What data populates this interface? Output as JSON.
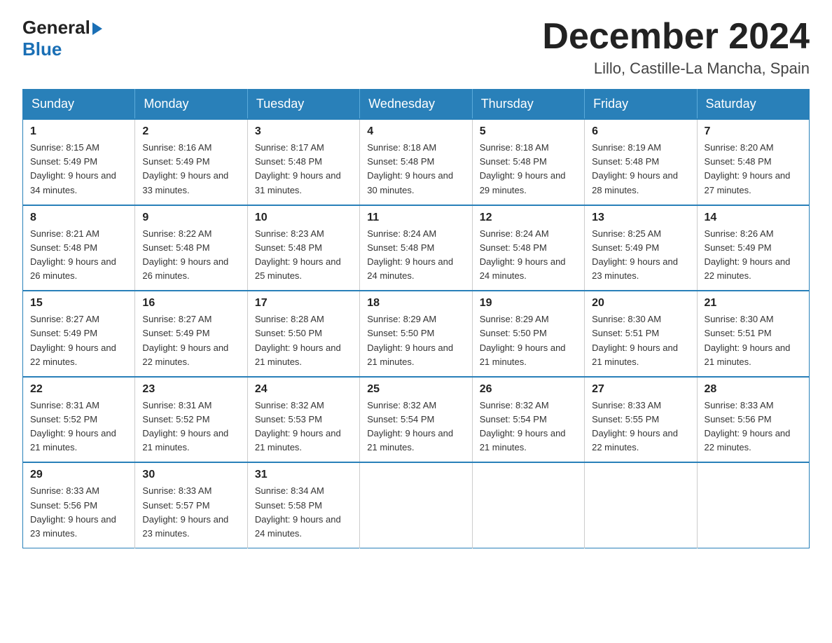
{
  "header": {
    "logo_general": "General",
    "logo_blue": "Blue",
    "month_title": "December 2024",
    "location": "Lillo, Castille-La Mancha, Spain"
  },
  "days_of_week": [
    "Sunday",
    "Monday",
    "Tuesday",
    "Wednesday",
    "Thursday",
    "Friday",
    "Saturday"
  ],
  "weeks": [
    [
      {
        "day": "1",
        "sunrise": "8:15 AM",
        "sunset": "5:49 PM",
        "daylight": "9 hours and 34 minutes."
      },
      {
        "day": "2",
        "sunrise": "8:16 AM",
        "sunset": "5:49 PM",
        "daylight": "9 hours and 33 minutes."
      },
      {
        "day": "3",
        "sunrise": "8:17 AM",
        "sunset": "5:48 PM",
        "daylight": "9 hours and 31 minutes."
      },
      {
        "day": "4",
        "sunrise": "8:18 AM",
        "sunset": "5:48 PM",
        "daylight": "9 hours and 30 minutes."
      },
      {
        "day": "5",
        "sunrise": "8:18 AM",
        "sunset": "5:48 PM",
        "daylight": "9 hours and 29 minutes."
      },
      {
        "day": "6",
        "sunrise": "8:19 AM",
        "sunset": "5:48 PM",
        "daylight": "9 hours and 28 minutes."
      },
      {
        "day": "7",
        "sunrise": "8:20 AM",
        "sunset": "5:48 PM",
        "daylight": "9 hours and 27 minutes."
      }
    ],
    [
      {
        "day": "8",
        "sunrise": "8:21 AM",
        "sunset": "5:48 PM",
        "daylight": "9 hours and 26 minutes."
      },
      {
        "day": "9",
        "sunrise": "8:22 AM",
        "sunset": "5:48 PM",
        "daylight": "9 hours and 26 minutes."
      },
      {
        "day": "10",
        "sunrise": "8:23 AM",
        "sunset": "5:48 PM",
        "daylight": "9 hours and 25 minutes."
      },
      {
        "day": "11",
        "sunrise": "8:24 AM",
        "sunset": "5:48 PM",
        "daylight": "9 hours and 24 minutes."
      },
      {
        "day": "12",
        "sunrise": "8:24 AM",
        "sunset": "5:48 PM",
        "daylight": "9 hours and 24 minutes."
      },
      {
        "day": "13",
        "sunrise": "8:25 AM",
        "sunset": "5:49 PM",
        "daylight": "9 hours and 23 minutes."
      },
      {
        "day": "14",
        "sunrise": "8:26 AM",
        "sunset": "5:49 PM",
        "daylight": "9 hours and 22 minutes."
      }
    ],
    [
      {
        "day": "15",
        "sunrise": "8:27 AM",
        "sunset": "5:49 PM",
        "daylight": "9 hours and 22 minutes."
      },
      {
        "day": "16",
        "sunrise": "8:27 AM",
        "sunset": "5:49 PM",
        "daylight": "9 hours and 22 minutes."
      },
      {
        "day": "17",
        "sunrise": "8:28 AM",
        "sunset": "5:50 PM",
        "daylight": "9 hours and 21 minutes."
      },
      {
        "day": "18",
        "sunrise": "8:29 AM",
        "sunset": "5:50 PM",
        "daylight": "9 hours and 21 minutes."
      },
      {
        "day": "19",
        "sunrise": "8:29 AM",
        "sunset": "5:50 PM",
        "daylight": "9 hours and 21 minutes."
      },
      {
        "day": "20",
        "sunrise": "8:30 AM",
        "sunset": "5:51 PM",
        "daylight": "9 hours and 21 minutes."
      },
      {
        "day": "21",
        "sunrise": "8:30 AM",
        "sunset": "5:51 PM",
        "daylight": "9 hours and 21 minutes."
      }
    ],
    [
      {
        "day": "22",
        "sunrise": "8:31 AM",
        "sunset": "5:52 PM",
        "daylight": "9 hours and 21 minutes."
      },
      {
        "day": "23",
        "sunrise": "8:31 AM",
        "sunset": "5:52 PM",
        "daylight": "9 hours and 21 minutes."
      },
      {
        "day": "24",
        "sunrise": "8:32 AM",
        "sunset": "5:53 PM",
        "daylight": "9 hours and 21 minutes."
      },
      {
        "day": "25",
        "sunrise": "8:32 AM",
        "sunset": "5:54 PM",
        "daylight": "9 hours and 21 minutes."
      },
      {
        "day": "26",
        "sunrise": "8:32 AM",
        "sunset": "5:54 PM",
        "daylight": "9 hours and 21 minutes."
      },
      {
        "day": "27",
        "sunrise": "8:33 AM",
        "sunset": "5:55 PM",
        "daylight": "9 hours and 22 minutes."
      },
      {
        "day": "28",
        "sunrise": "8:33 AM",
        "sunset": "5:56 PM",
        "daylight": "9 hours and 22 minutes."
      }
    ],
    [
      {
        "day": "29",
        "sunrise": "8:33 AM",
        "sunset": "5:56 PM",
        "daylight": "9 hours and 23 minutes."
      },
      {
        "day": "30",
        "sunrise": "8:33 AM",
        "sunset": "5:57 PM",
        "daylight": "9 hours and 23 minutes."
      },
      {
        "day": "31",
        "sunrise": "8:34 AM",
        "sunset": "5:58 PM",
        "daylight": "9 hours and 24 minutes."
      },
      null,
      null,
      null,
      null
    ]
  ]
}
